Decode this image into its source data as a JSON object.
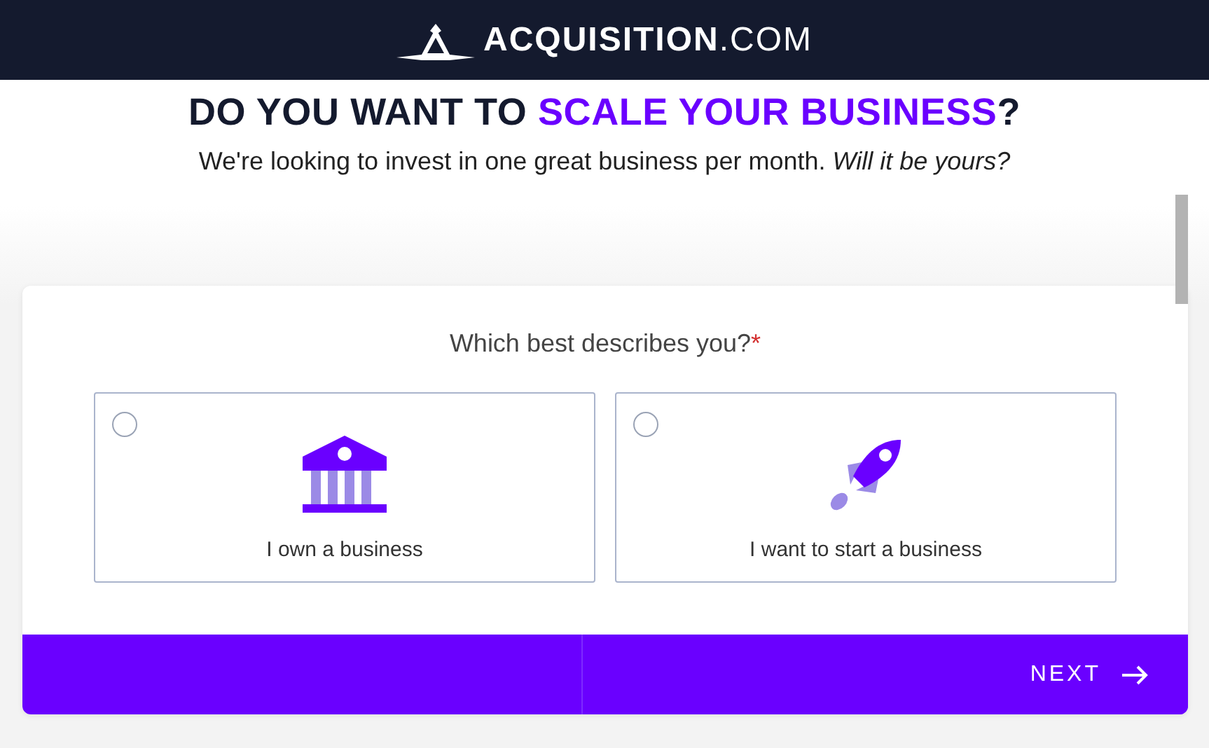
{
  "header": {
    "logo_text": "ACQUISITION",
    "logo_suffix": ".COM"
  },
  "headline": {
    "before": "DO YOU WANT TO ",
    "highlight": "SCALE YOUR BUSINESS",
    "after": "?"
  },
  "subtitle": "We're looking to invest in one great business per month. *Will it be yours?*",
  "form": {
    "question": "Which best describes you?",
    "required_mark": "*",
    "options": [
      {
        "kind": "bank",
        "label": "I own a business",
        "selected": false
      },
      {
        "kind": "rocket",
        "label": "I want to start a business",
        "selected": false
      }
    ],
    "next_button": "NEXT"
  }
}
